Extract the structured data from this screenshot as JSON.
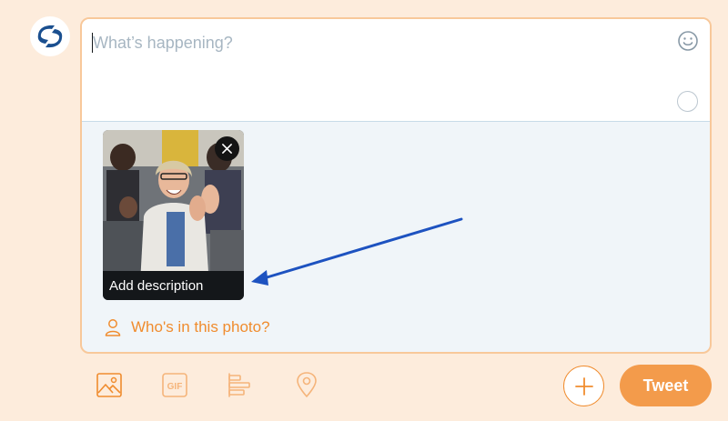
{
  "composer": {
    "placeholder": "What’s happening?",
    "value": "",
    "icons": {
      "emoji": "emoji-icon",
      "counter": "character-counter-ring"
    }
  },
  "media": {
    "add_description_label": "Add description",
    "remove_icon": "close-icon"
  },
  "tag_people": {
    "label": "Who's in this photo?",
    "icon": "person-icon"
  },
  "toolbar": {
    "icons": [
      "image-icon",
      "gif-icon",
      "poll-icon",
      "location-icon"
    ],
    "gif_label": "GIF",
    "plus_icon": "plus-icon",
    "tweet_label": "Tweet"
  },
  "colors": {
    "background": "#fdecdc",
    "accent": "#f08c2e",
    "tweet_button": "#f39b4b",
    "annotation_arrow": "#1d52c0"
  }
}
